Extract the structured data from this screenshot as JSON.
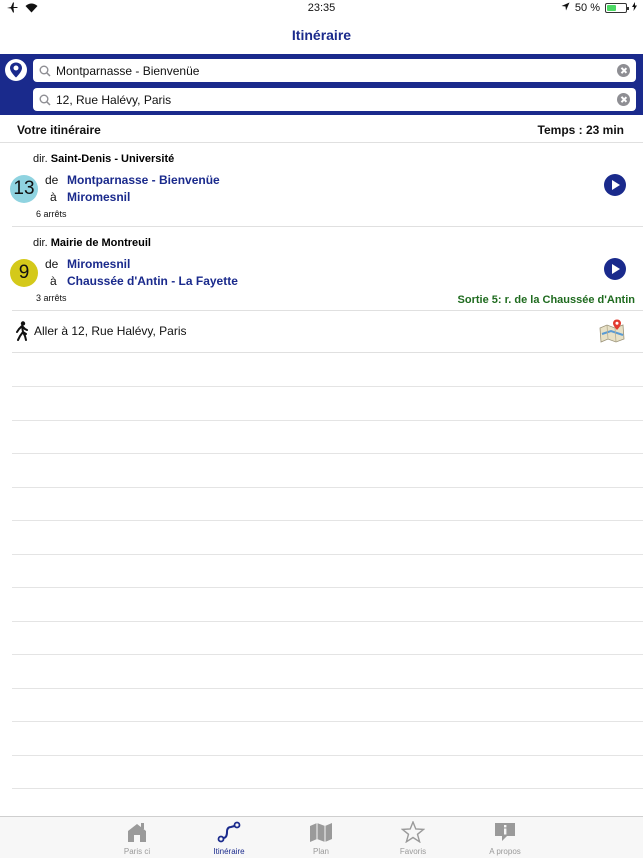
{
  "status_bar": {
    "time": "23:35",
    "battery_text": "50 %",
    "battery_level": 0.5
  },
  "nav": {
    "title": "Itinéraire"
  },
  "search": {
    "origin": "Montparnasse - Bienvenüe",
    "destination": "12, Rue Halévy, Paris"
  },
  "summary": {
    "label": "Votre itinéraire",
    "time": "Temps : 23 min"
  },
  "legs": [
    {
      "line": "13",
      "line_color": "#8fd3e0",
      "dir_prefix": "dir.",
      "direction": "Saint-Denis - Université",
      "from_label": "de",
      "from": "Montparnasse - Bienvenüe",
      "to_label": "à",
      "to": "Miromesnil",
      "stops": "6 arrêts",
      "exit": ""
    },
    {
      "line": "9",
      "line_color": "#d4c91a",
      "dir_prefix": "dir.",
      "direction": "Mairie de Montreuil",
      "from_label": "de",
      "from": "Miromesnil",
      "to_label": "à",
      "to": "Chaussée d'Antin - La Fayette",
      "stops": "3 arrêts",
      "exit": "Sortie 5: r. de la Chaussée d'Antin"
    }
  ],
  "walk": {
    "text": "Aller à 12, Rue Halévy, Paris"
  },
  "colors": {
    "brand_blue": "#1a2a8c",
    "exit_green": "#1f6b1f"
  },
  "tabs": [
    {
      "label": "Paris ci",
      "icon": "house-icon",
      "active": false
    },
    {
      "label": "Itinéraire",
      "icon": "route-icon",
      "active": true
    },
    {
      "label": "Plan",
      "icon": "map-icon",
      "active": false
    },
    {
      "label": "Favoris",
      "icon": "star-icon",
      "active": false
    },
    {
      "label": "A propos",
      "icon": "info-icon",
      "active": false
    }
  ]
}
